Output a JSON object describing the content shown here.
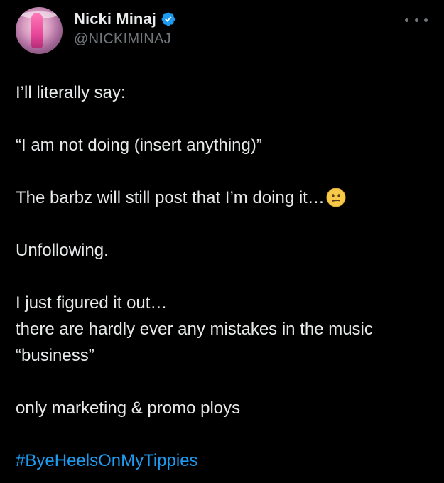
{
  "user": {
    "display_name": "Nicki Minaj",
    "handle": "@NICKIMINAJ",
    "verified": true,
    "verified_color": "#1d9bf0"
  },
  "tweet": {
    "line1": "I’ll literally say:",
    "line2": "“I am not doing (insert anything)”",
    "line3": "The barbz will still post that I’m doing it…",
    "line3_emoji": "neutral-face-emoji",
    "line4": "Unfollowing.",
    "line5a": "I just figured it out…",
    "line5b": "there are hardly ever any mistakes in the music",
    "line5c": "“business”",
    "line6": "only marketing & promo ploys",
    "hashtag": "#ByeHeelsOnMyTippies"
  },
  "colors": {
    "background": "#000000",
    "text": "#e7e9ea",
    "muted": "#71767b",
    "link": "#1d9bf0"
  }
}
